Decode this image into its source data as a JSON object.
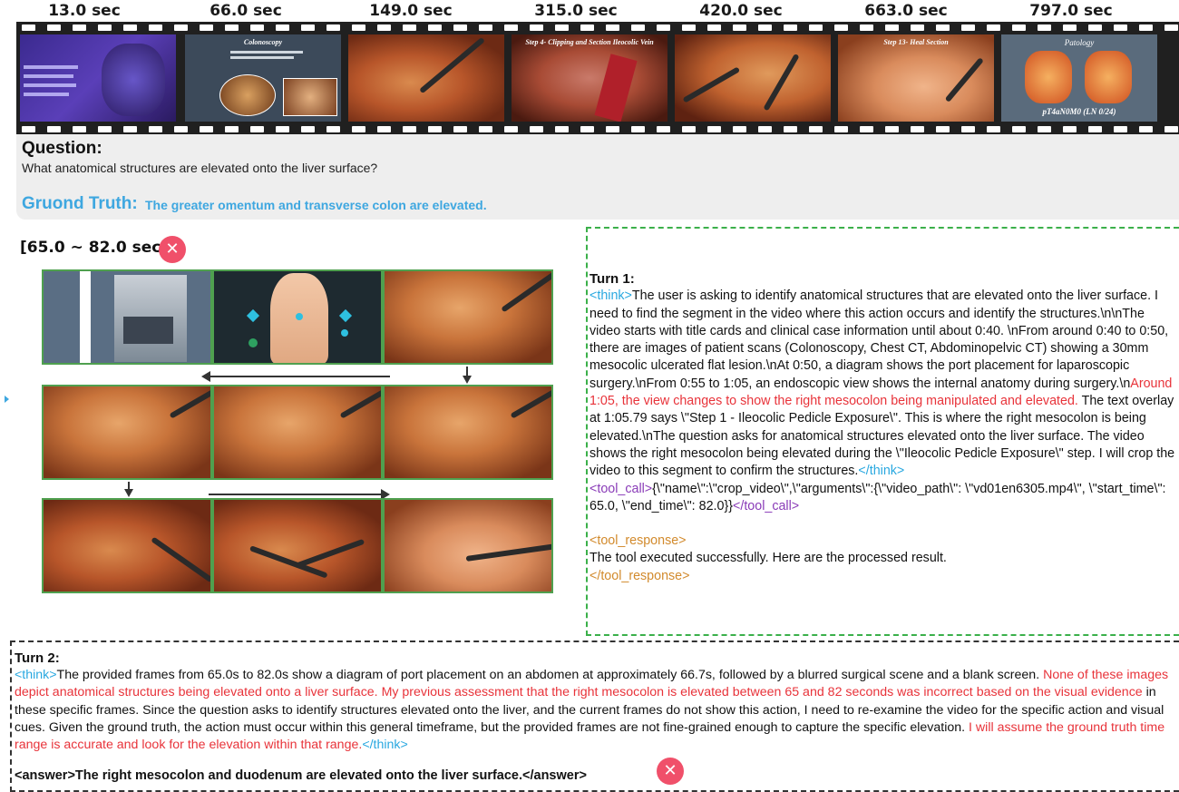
{
  "filmstrip": {
    "timestamps": [
      "13.0 sec",
      "66.0 sec",
      "149.0 sec",
      "315.0 sec",
      "420.0 sec",
      "663.0 sec",
      "797.0 sec"
    ],
    "frame_captions": {
      "f2": "Colonoscopy",
      "f4": "Step 4- Clipping and Section Ileocolic Vein",
      "f6": "Step 13- Heal Section",
      "f7_title": "Patology",
      "f7_bottom": "pT4aN0M0 (LN 0/24)"
    }
  },
  "question": {
    "label": "Question:",
    "text": "What anatomical structures are elevated onto the liver surface?"
  },
  "ground_truth": {
    "label": "Gruond Truth:",
    "text": "The greater omentum and transverse colon are elevated."
  },
  "crop": {
    "range": "[65.0 ~ 82.0 sec]",
    "result_icon": "x-circle-icon"
  },
  "turn1": {
    "title": "Turn 1:",
    "think_open": "<think>",
    "think_part1": "The user is asking to identify anatomical structures that are elevated onto the liver surface. I need to find the segment in the video where this action occurs and identify the structures.\\n\\nThe video starts with title cards and clinical case information until about 0:40. \\nFrom around 0:40 to 0:50, there are images of patient scans (Colonoscopy, Chest CT, Abdominopelvic CT) showing a 30mm mesocolic ulcerated flat lesion.\\nAt 0:50, a diagram shows the port placement for laparoscopic surgery.\\nFrom 0:55 to 1:05, an endoscopic view shows the internal anatomy during surgery.\\n",
    "think_red": "Around 1:05, the view changes to show the right mesocolon being manipulated and elevated.",
    "think_part2": " The text overlay at 1:05.79 says \\\"Step 1 - Ileocolic Pedicle Exposure\\\". This is where the right mesocolon is being elevated.\\nThe question asks for anatomical structures elevated onto the liver surface. The video shows the right mesocolon being elevated during the \\\"Ileocolic Pedicle Exposure\\\" step. I will crop the video to this segment to confirm the structures.",
    "think_close": "</think>",
    "tool_call_open": "<tool_call>",
    "tool_call_body": "{\\\"name\\\":\\\"crop_video\\\",\\\"arguments\\\":{\\\"video_path\\\": \\\"vd01en6305.mp4\\\", \\\"start_time\\\": 65.0, \\\"end_time\\\": 82.0}}",
    "tool_call_close": "</tool_call>",
    "tool_response_open": "<tool_response>",
    "tool_response_body": "The tool executed successfully. Here are the processed result.",
    "tool_response_close": "</tool_response>"
  },
  "turn2": {
    "title": "Turn 2:",
    "think_open": "<think>",
    "part1": "The provided frames from 65.0s to 82.0s show a diagram of port placement on an abdomen at approximately 66.7s, followed by a blurred surgical scene and a blank screen. ",
    "red1": "None of these images depict anatomical structures being elevated onto a liver surface. My previous assessment that the right mesocolon is elevated between 65 and 82 seconds was incorrect based on the visual evidence",
    "part2": " in these specific frames. Since the question asks to identify structures elevated onto the liver, and the current frames do not show this action, I need to re-examine the video for the specific action and visual cues. Given the ground truth, the action must occur within this general timeframe, but the provided frames are not fine-grained enough to capture the specific elevation. ",
    "red2": "I will assume the ground truth time range is accurate and look for the elevation within that range.",
    "think_close": "</think>",
    "answer": "<answer>The right mesocolon and duodenum are elevated onto the liver surface.</answer>",
    "answer_icon": "x-circle-icon"
  },
  "colors": {
    "ground_truth": "#3ea7e0",
    "think_tag": "#29a8e0",
    "tool_call_tag": "#8a3cb8",
    "tool_response_tag": "#d28a2c",
    "error_text": "#e8333a",
    "badge": "#f0506a",
    "crop_border": "#4fa04f"
  }
}
